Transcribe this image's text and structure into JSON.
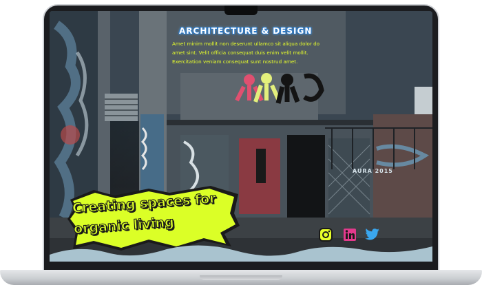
{
  "hero": {
    "title": "ARCHITECTURE & DESIGN",
    "description": "Amet minim mollit non deserunt ullamco sit aliqua dolor do amet sint. Velit officia consequat duis enim velit mollit. Exercitation veniam consequat sunt nostrud amet.",
    "tagline": "Creating spaces for organic living",
    "graffiti_text": "AURA 2015"
  },
  "social": [
    {
      "name": "instagram",
      "icon": "instagram-icon",
      "color": "#e8ff2a"
    },
    {
      "name": "linkedin",
      "icon": "linkedin-icon",
      "color": "#e23a8c"
    },
    {
      "name": "twitter",
      "icon": "twitter-icon",
      "color": "#3aa7ef"
    }
  ],
  "colors": {
    "accent_lime": "#dbff27",
    "title_blue": "#2a78c8",
    "wave_blue": "#a9c3cf"
  }
}
